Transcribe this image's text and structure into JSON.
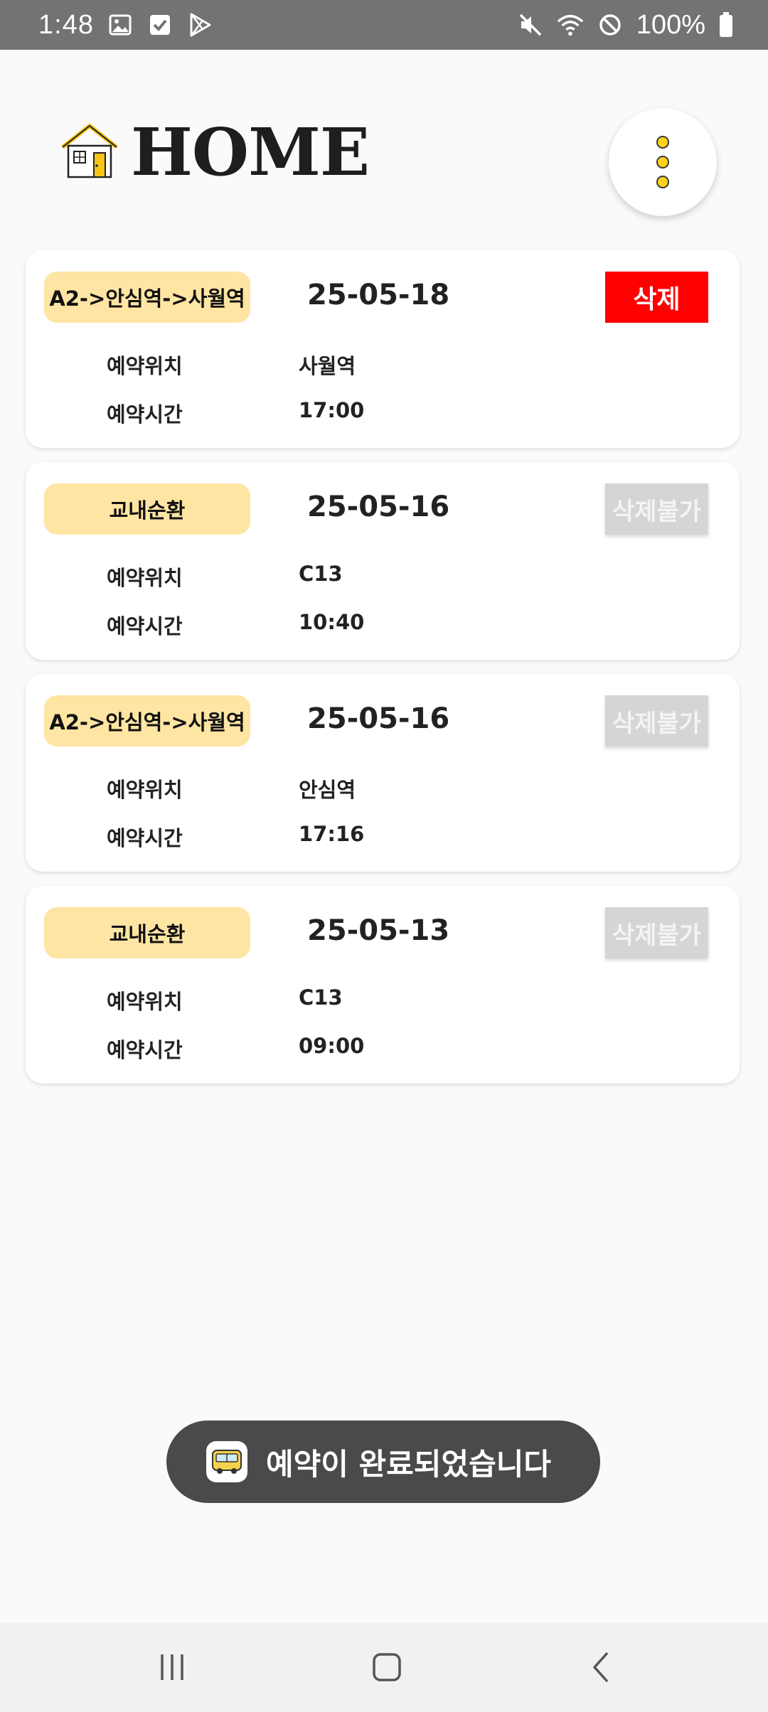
{
  "status_bar": {
    "time": "1:48",
    "battery": "100%",
    "left_icons": [
      "gallery-icon",
      "checkbox-icon",
      "play-store-icon"
    ],
    "right_icons": [
      "mute-icon",
      "wifi-icon",
      "do-not-disturb-icon",
      "battery-icon"
    ]
  },
  "header": {
    "title": "HOME",
    "icon": "house-icon"
  },
  "reservations": [
    {
      "route": "A2->안심역->사월역",
      "date": "25-05-18",
      "action": "삭제",
      "action_state": "active",
      "location_label": "예약위치",
      "location": "사월역",
      "time_label": "예약시간",
      "time": "17:00"
    },
    {
      "route": "교내순환",
      "date": "25-05-16",
      "action": "삭제불가",
      "action_state": "disabled",
      "location_label": "예약위치",
      "location": "C13",
      "time_label": "예약시간",
      "time": "10:40"
    },
    {
      "route": "A2->안심역->사월역",
      "date": "25-05-16",
      "action": "삭제불가",
      "action_state": "disabled",
      "location_label": "예약위치",
      "location": "안심역",
      "time_label": "예약시간",
      "time": "17:16"
    },
    {
      "route": "교내순환",
      "date": "25-05-13",
      "action": "삭제불가",
      "action_state": "disabled",
      "location_label": "예약위치",
      "location": "C13",
      "time_label": "예약시간",
      "time": "09:00"
    }
  ],
  "toast": {
    "message": "예약이 완료되었습니다",
    "icon": "bus-icon"
  },
  "colors": {
    "badge": "#ffe5a3",
    "delete_active": "#ff0000",
    "delete_disabled": "#d5d5d5",
    "menu_dot": "#ffd21c"
  }
}
